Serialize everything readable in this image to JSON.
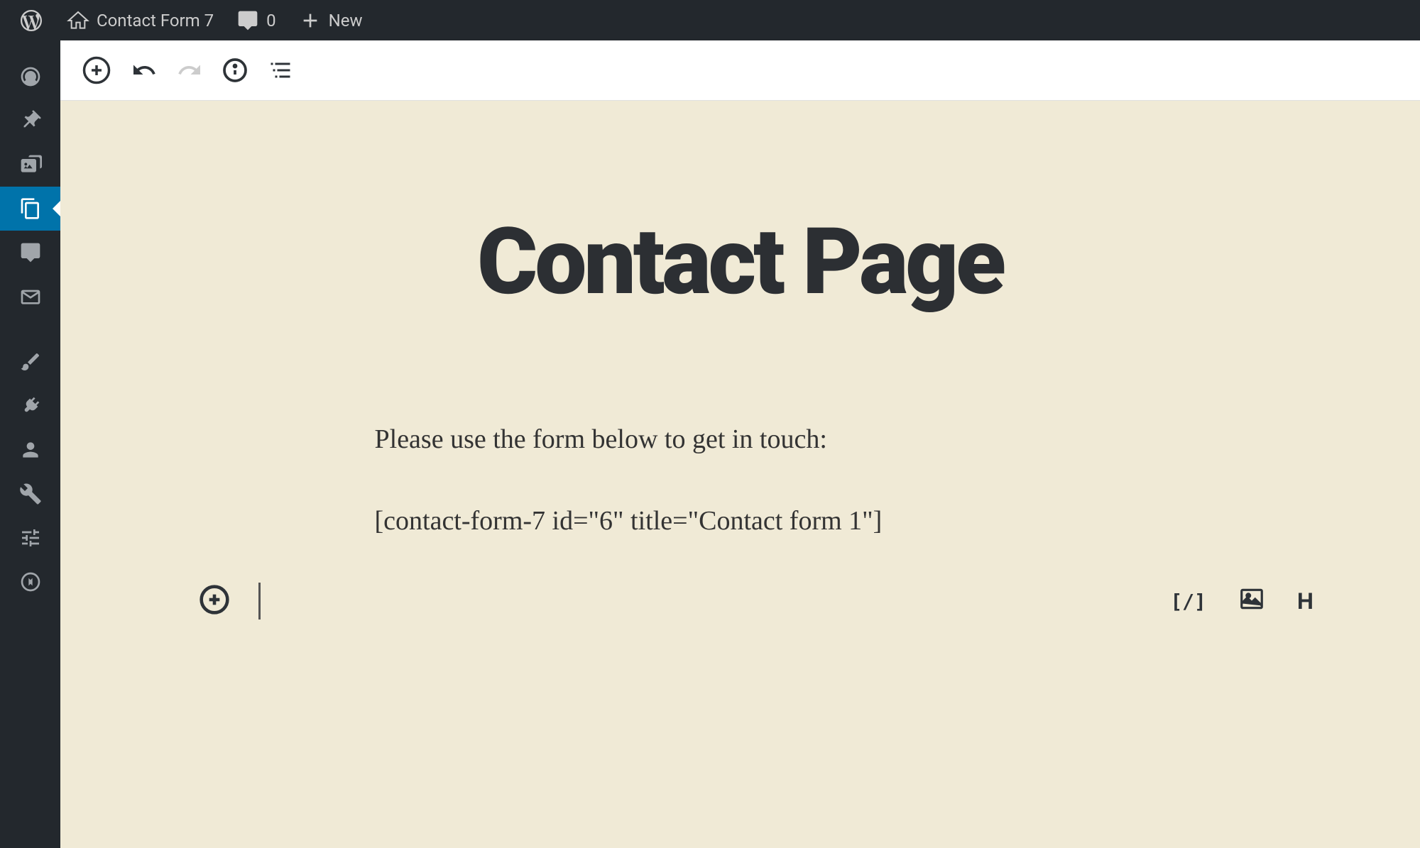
{
  "adminBar": {
    "siteName": "Contact Form 7",
    "commentsCount": "0",
    "newLabel": "New"
  },
  "editor": {
    "title": "Contact Page",
    "paragraph": "Please use the form below to get in touch:",
    "shortcode": "[contact-form-7 id=\"6\" title=\"Contact form 1\"]"
  },
  "inserter": {
    "shortcodeIcon": "[/]",
    "headingLetter": "H"
  }
}
